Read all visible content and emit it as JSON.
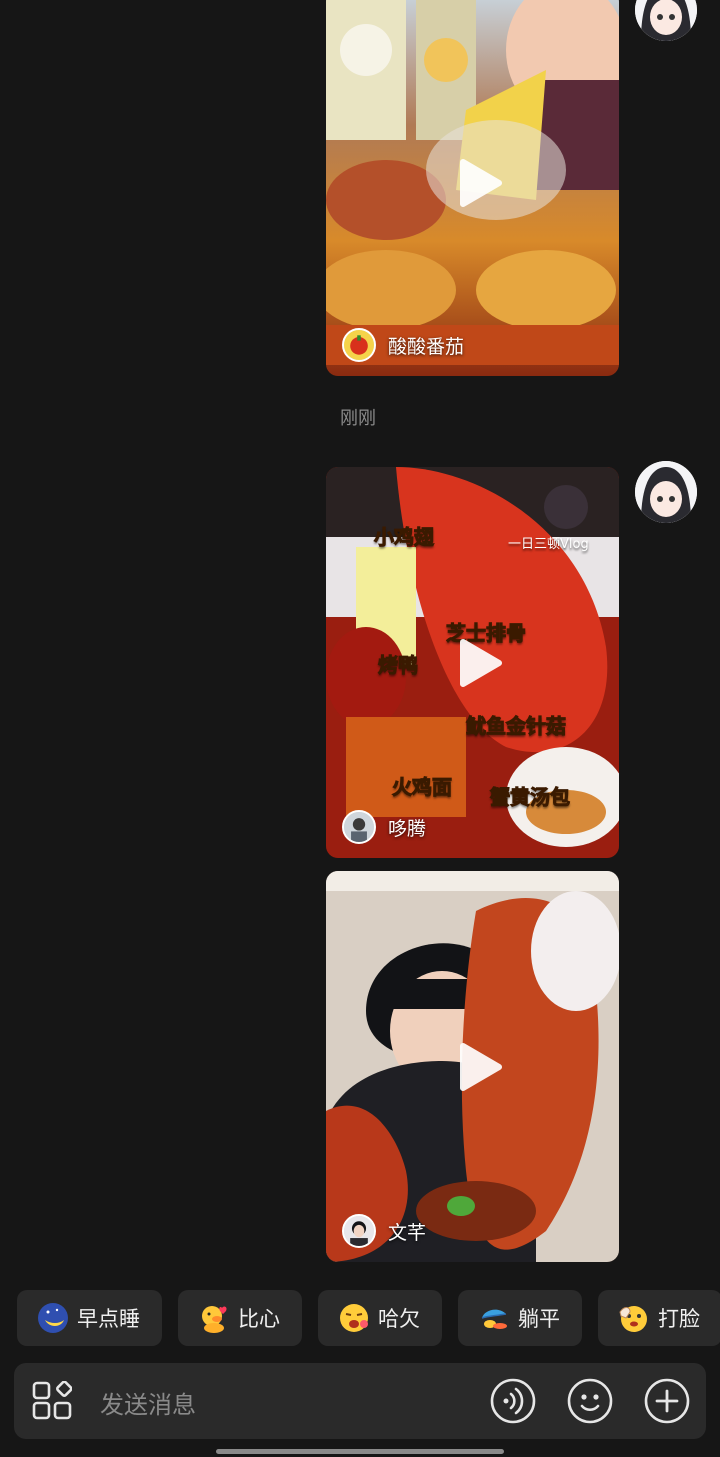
{
  "messages": [
    {
      "author": "酸酸番茄",
      "cropped_top": true
    },
    {
      "timestamp": "刚刚"
    },
    {
      "author": "哆腾",
      "overlay_labels": [
        "小鸡翅",
        "一日三顿Vlog",
        "芝士排骨",
        "烤鸭",
        "鱿鱼金针菇",
        "火鸡面",
        "蟹黄汤包"
      ]
    },
    {
      "author": "文芊"
    }
  ],
  "quick_replies": [
    {
      "icon": "moon-sleep-emoji-icon",
      "label": "早点睡"
    },
    {
      "icon": "duck-heart-emoji-icon",
      "label": "比心"
    },
    {
      "icon": "yawn-emoji-icon",
      "label": "哈欠"
    },
    {
      "icon": "lie-flat-emoji-icon",
      "label": "躺平"
    },
    {
      "icon": "face-slap-emoji-icon",
      "label": "打脸"
    }
  ],
  "input": {
    "placeholder": "发送消息",
    "left_icon": "apps-grid-icon",
    "right_icons": [
      "voice-icon",
      "emoji-icon",
      "plus-icon"
    ]
  },
  "colors": {
    "background": "#161616",
    "chip_bg": "#2a2a2a",
    "input_bg": "#2a2a2a",
    "muted_text": "#8c8c8c"
  }
}
